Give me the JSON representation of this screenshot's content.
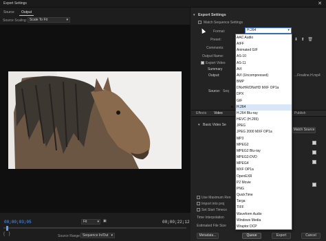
{
  "window": {
    "title": "Export Settings",
    "close": "✕"
  },
  "left": {
    "tabs": [
      "Source",
      "Output"
    ],
    "active_tab": "Output",
    "source_scaling_label": "Source Scaling:",
    "source_scaling_value": "Scale To Fit",
    "timecode_current": "00;00;03;05",
    "timecode_end": "00;00;22;12",
    "fit_value": "Fit",
    "source_range_label": "Source Range:",
    "source_range_value": "Sequence In/Out"
  },
  "right": {
    "section_title": "Export Settings",
    "match_sequence_label": "Match Sequence Settings",
    "format_label": "Format:",
    "format_value": "H.264",
    "preset_label": "Preset:",
    "comments_label": "Comments:",
    "output_name_label": "Output Name:",
    "export_video_label": "Export Video",
    "summary_label": "Summary",
    "output_label": "Output:",
    "output_value": "...Finaline.H.mp4",
    "source_label": "Source:",
    "source_value": "Seq",
    "tabs": [
      "Effects",
      "Video",
      "Publish"
    ],
    "basic_video_label": "Basic Video Se",
    "match_source_button": "Match Source",
    "use_max_render_label": "Use Maximum Ren",
    "import_into_project_label": "Import into proj",
    "set_start_timecode_label": "Set Start Timeco",
    "time_interpolation_label": "Time Interpolation",
    "estimated_file_size_label": "Estimated File Size",
    "metadata_button": "Metadata...",
    "queue_button": "Queue",
    "export_button": "Export",
    "cancel_button": "Cancel"
  },
  "format_dropdown": {
    "selected": "H.264",
    "items": [
      "AAC Audio",
      "AIFF",
      "Animated GIF",
      "AS-10",
      "AS-11",
      "AVI",
      "AVI (Uncompressed)",
      "BMP",
      "DNxHR/DNxHD MXF OP1a",
      "DPX",
      "GIF",
      "H.264",
      "H.264 Blu-ray",
      "HEVC (H.265)",
      "JPEG",
      "JPEG 2000 MXF OP1a",
      "MP3",
      "MPEG2",
      "MPEG2 Blu-ray",
      "MPEG2-DVD",
      "MPEG4",
      "MXF OP1a",
      "OpenEXR",
      "P2 Movie",
      "PNG",
      "QuickTime",
      "Targa",
      "TIFF",
      "Waveform Audio",
      "Windows Media",
      "Wraptor DCP"
    ]
  },
  "colors": {
    "accent": "#5aa0ff",
    "panel": "#232323",
    "selection": "#d9e6f7"
  }
}
